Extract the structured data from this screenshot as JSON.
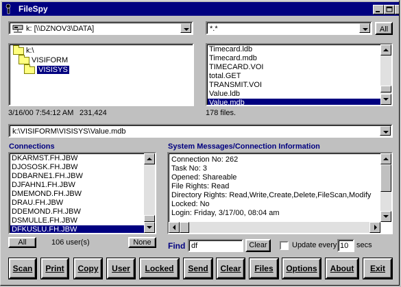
{
  "window": {
    "title": "FileSpy"
  },
  "drive": {
    "value": "k: [\\\\DZNOV3\\DATA]"
  },
  "filter": {
    "value": "*.*",
    "all_label": "All"
  },
  "folders": [
    {
      "label": "k:\\",
      "indent": 0,
      "selected": false
    },
    {
      "label": "VISIFORM",
      "indent": 1,
      "selected": false
    },
    {
      "label": "VISISYS",
      "indent": 2,
      "selected": true
    }
  ],
  "files": [
    {
      "label": "Timecard.ldb",
      "selected": false
    },
    {
      "label": "Timecard.mdb",
      "selected": false
    },
    {
      "label": "TIMECARD.VOI",
      "selected": false
    },
    {
      "label": "total.GET",
      "selected": false
    },
    {
      "label": "TRANSMIT.VOI",
      "selected": false
    },
    {
      "label": "Value.ldb",
      "selected": false
    },
    {
      "label": "Value.mdb",
      "selected": true
    }
  ],
  "file_info": {
    "date": "3/16/00 7:54:12 AM",
    "size": "231,424",
    "count": "178 files."
  },
  "path": {
    "value": "k:\\VISIFORM\\VISISYS\\Value.mdb"
  },
  "connections": {
    "heading": "Connections",
    "items": [
      {
        "label": "DKARMST.FH.JBW",
        "selected": false
      },
      {
        "label": "DJOSOSK.FH.JBW",
        "selected": false
      },
      {
        "label": "DDBARNE1.FH.JBW",
        "selected": false
      },
      {
        "label": "DJFAHN1.FH.JBW",
        "selected": false
      },
      {
        "label": "DMEMOND.FH.JBW",
        "selected": false
      },
      {
        "label": "DRAU.FH.JBW",
        "selected": false
      },
      {
        "label": "DDEMOND.FH.JBW",
        "selected": false
      },
      {
        "label": "DSMULLE.FH.JBW",
        "selected": false
      },
      {
        "label": "DFKUSLU.FH.JBW",
        "selected": true
      }
    ],
    "all_label": "All",
    "user_count": "106 user(s)",
    "none_label": "None"
  },
  "messages": {
    "heading": "System Messages/Connection Information",
    "lines": [
      "Connection No: 262",
      "Task No: 3",
      "Opened: Shareable",
      "File Rights: Read",
      "Directory Rights: Read,Write,Create,Delete,FileScan,Modify",
      "Locked: No",
      "Login: Friday, 3/17/00, 08:04 am"
    ]
  },
  "find": {
    "label": "Find",
    "value": "df",
    "clear_label": "Clear"
  },
  "update": {
    "label": "Update every",
    "value": "10",
    "unit": "secs",
    "checked": false
  },
  "toolbar": [
    {
      "name": "scan-button",
      "label": "Scan"
    },
    {
      "name": "print-button",
      "label": "Print"
    },
    {
      "name": "copy-button",
      "label": "Copy"
    },
    {
      "name": "user-button",
      "label": "User"
    },
    {
      "name": "locked-button",
      "label": "Locked"
    },
    {
      "name": "send-button",
      "label": "Send"
    },
    {
      "name": "clear-button",
      "label": "Clear"
    },
    {
      "name": "files-button",
      "label": "Files"
    },
    {
      "name": "options-button",
      "label": "Options"
    },
    {
      "name": "about-button",
      "label": "About"
    },
    {
      "name": "exit-button",
      "label": "Exit"
    }
  ],
  "colors": {
    "titlebar": "#000080",
    "selection": "#000080",
    "face": "#c0c0c0"
  }
}
